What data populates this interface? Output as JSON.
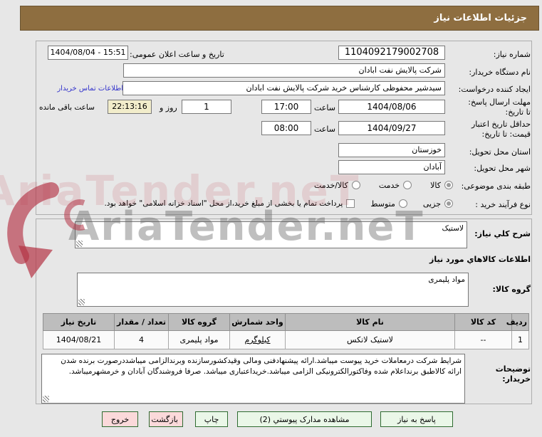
{
  "title": "جزئیات اطلاعات نیاز",
  "form": {
    "need_number": {
      "label": "شماره نیاز:",
      "value": "1104092179002708"
    },
    "announce": {
      "label": "تاریخ و ساعت اعلان عمومی:",
      "value": "1404/08/04 - 15:51"
    },
    "buyer_org": {
      "label": "نام دستگاه خریدار:",
      "value": "شرکت پالایش نفت ابادان"
    },
    "creator": {
      "label": "ایجاد کننده درخواست:",
      "value": "سیدشیر محفوظی کارشناس خرید شرکت پالایش نفت ابادان",
      "contact_link": "اطلاعات تماس خریدار"
    },
    "deadline": {
      "label": "مهلت ارسال پاسخ: تا تاریخ:",
      "date": "1404/08/06",
      "hour_label": "ساعت",
      "time": "17:00"
    },
    "remaining": {
      "days": "1",
      "days_label": "روز و",
      "time": "22:13:16",
      "suffix": "ساعت باقی مانده"
    },
    "validity": {
      "label": "حداقل تاریخ اعتبار قیمت: تا تاریخ:",
      "date": "1404/09/27",
      "hour_label": "ساعت",
      "time": "08:00"
    },
    "province": {
      "label": "استان محل تحویل:",
      "value": "خوزستان"
    },
    "city": {
      "label": "شهر محل تحویل:",
      "value": "آبادان"
    },
    "classification": {
      "label": "طبقه بندی موضوعی:",
      "options": [
        {
          "label": "کالا",
          "selected": true
        },
        {
          "label": "خدمت",
          "selected": false
        },
        {
          "label": "کالا/خدمت",
          "selected": false
        }
      ]
    },
    "process_type": {
      "label": "نوع فرآیند خرید :",
      "options": [
        {
          "label": "جزیی",
          "selected": true
        },
        {
          "label": "متوسط",
          "selected": false
        }
      ],
      "treasury_checkbox": {
        "label": "پرداخت تمام یا بخشی از مبلغ خرید،از محل \"اسناد خزانه اسلامی\" خواهد بود.",
        "checked": false
      }
    }
  },
  "goods": {
    "summary_label": "شرح کلي نیاز:",
    "summary_value": "لاستیک",
    "section_header": "اطلاعات کالاهاي مورد نیاز",
    "group_label": "گروه کالا:",
    "group_value": "مواد پلیمری",
    "table": {
      "headers": [
        "ردیف",
        "کد کالا",
        "نام کالا",
        "واحد شمارش",
        "گروه کالا",
        "تعداد / مقدار",
        "تاریخ نیاز"
      ],
      "rows": [
        [
          "1",
          "--",
          "لاستیک لاتکس",
          "کیلوگرم",
          "مواد پلیمری",
          "4",
          "1404/08/21"
        ]
      ]
    },
    "notes_label": "توضیحات خریدار:",
    "notes_value": "شرایط شرکت درمعاملات خرید پیوست میباشد.ارائه پیشنهادفنی ومالی وقیدکشورسازنده وبرندالزامی میباشددرصورت برنده شدن ارائه کالاطبق برنداعلام شده وفاکتورالکترونیکی الزامی میباشد.خریداعتباری میباشد. صرفا فروشندگان آبادان و خرمشهرمیباشد."
  },
  "buttons": [
    {
      "label": "پاسخ به نیاز",
      "style": "green"
    },
    {
      "label": "مشاهده مدارک پیوستي (2)",
      "style": "green"
    },
    {
      "label": "چاپ",
      "style": "green"
    },
    {
      "label": "بازگشت",
      "style": "pink"
    },
    {
      "label": "خروج",
      "style": "pink"
    }
  ],
  "watermark": {
    "text": "AriaTender.neT"
  },
  "colors": {
    "header_bg": "#8E6E40",
    "button_green_bg": "#EAF7E8",
    "button_pink_bg": "#FBD9DA",
    "link_blue": "#3333CC",
    "countdown_yellow": "#F2EDCB",
    "watermark_red": "#B43345",
    "table_header_bg": "#BDBDBD"
  }
}
